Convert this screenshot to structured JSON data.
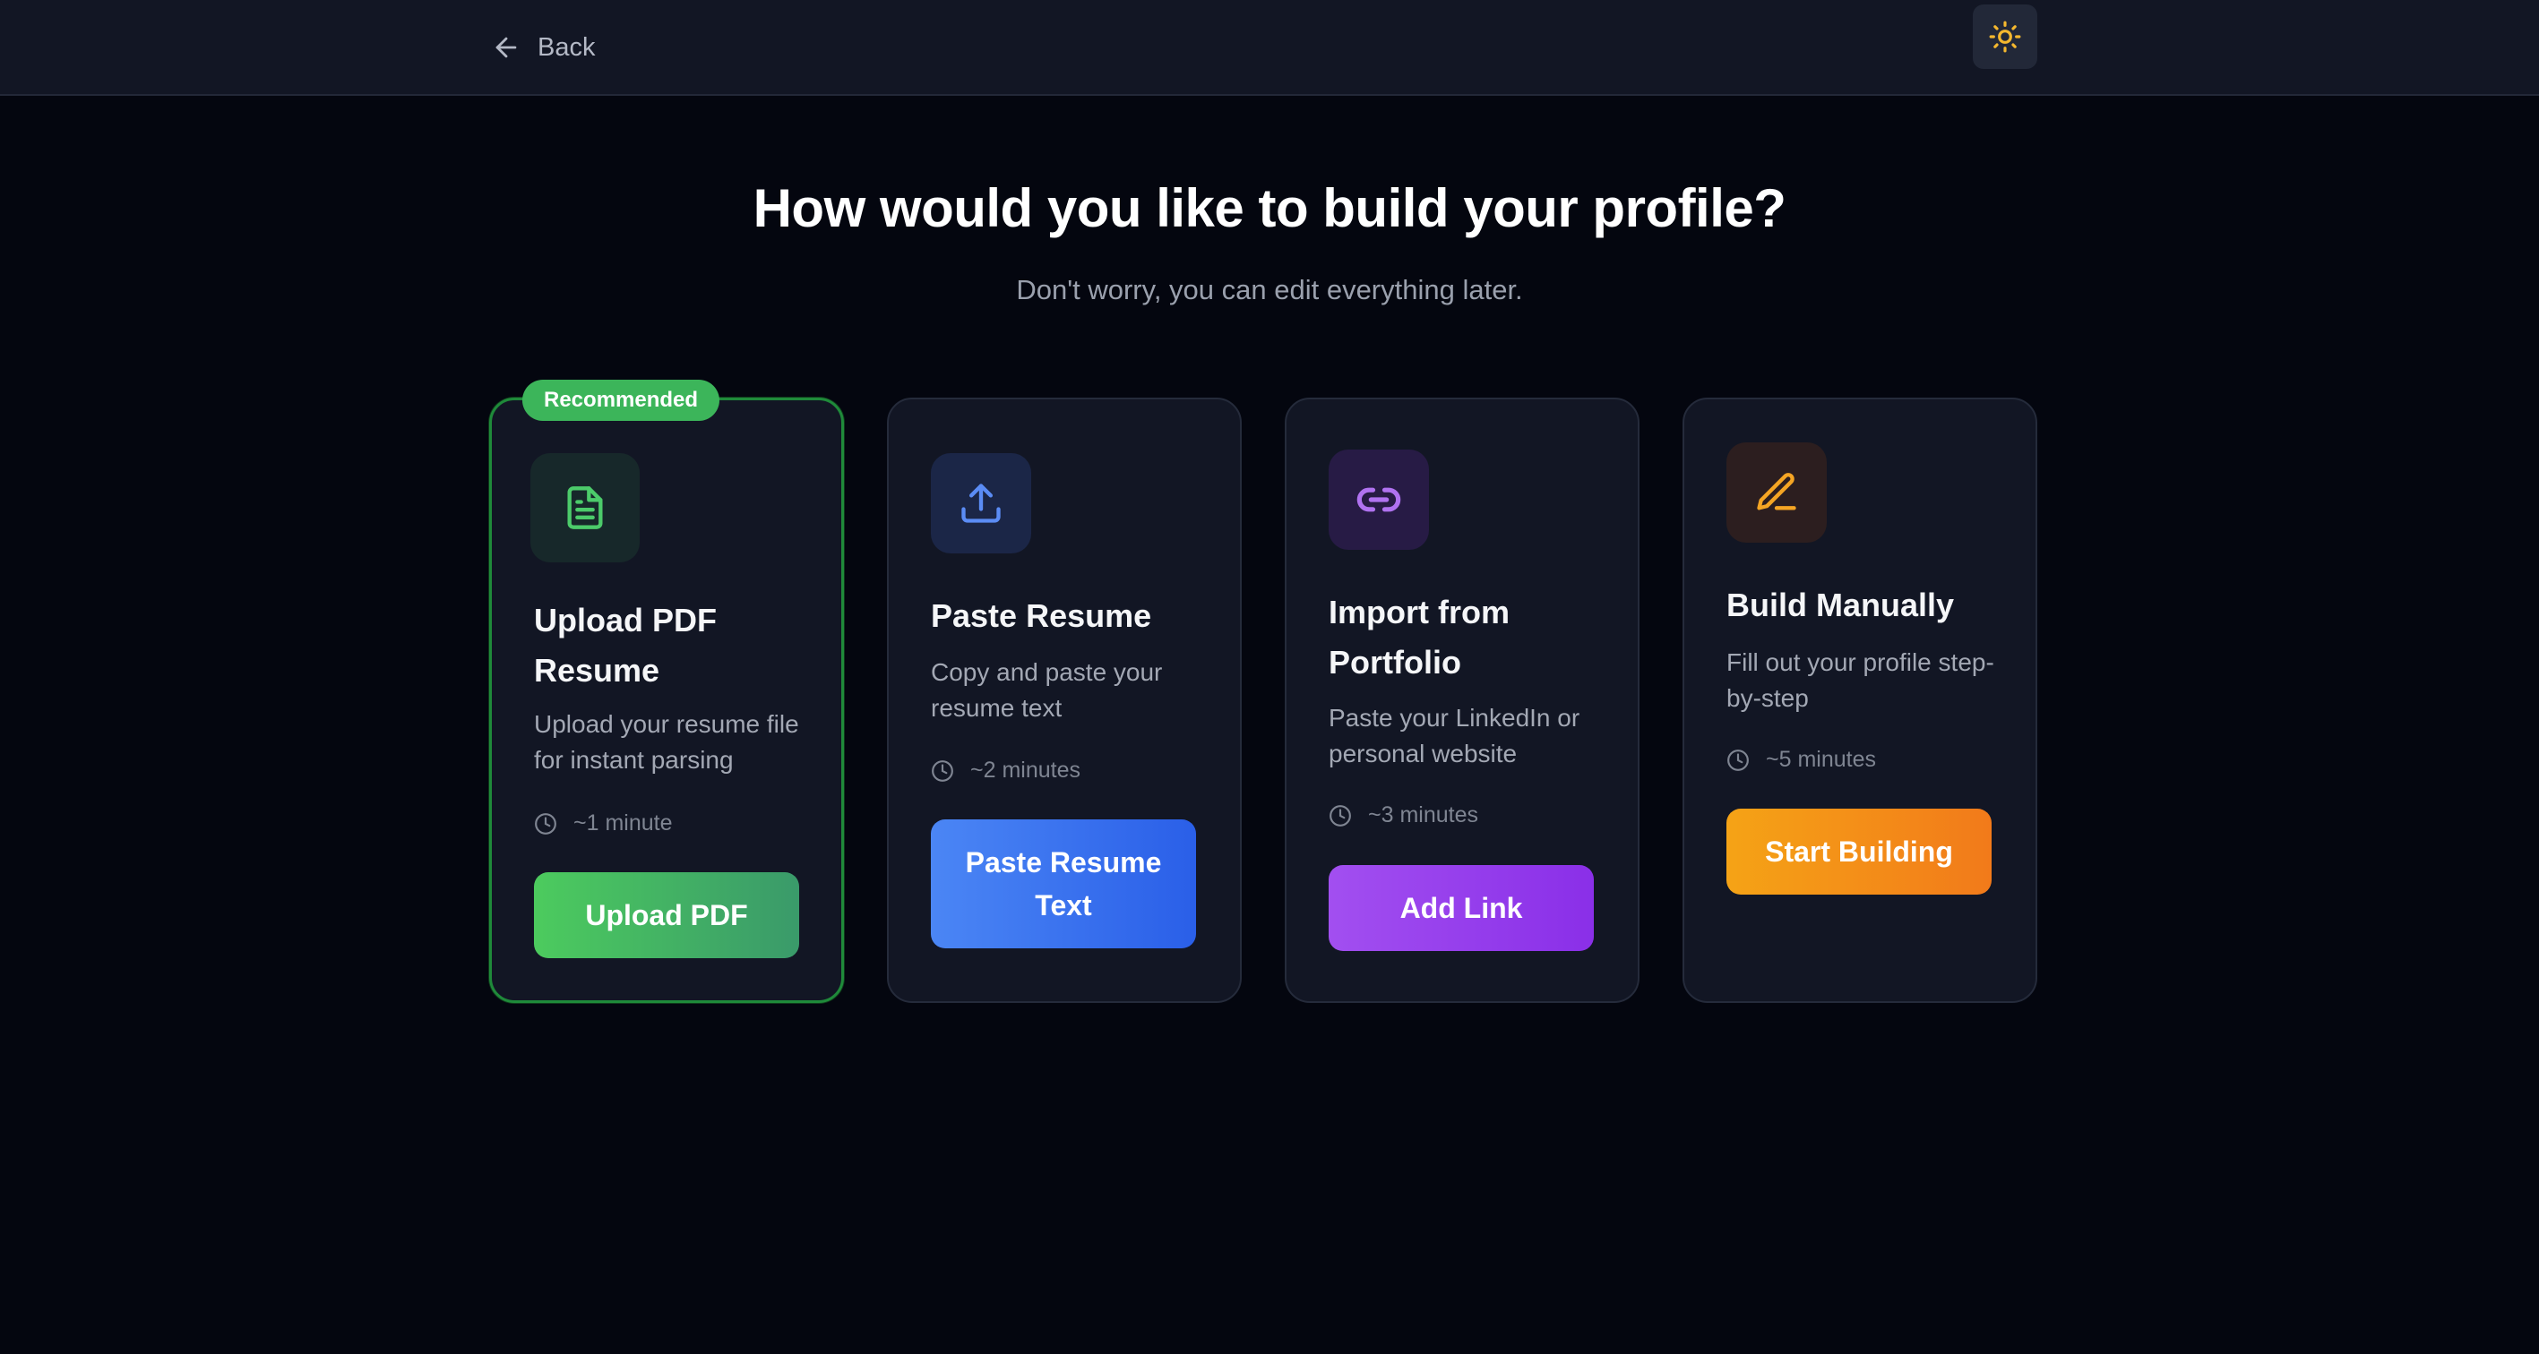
{
  "header": {
    "back_label": "Back"
  },
  "main": {
    "title": "How would you like to build your profile?",
    "subtitle": "Don't worry, you can edit everything later."
  },
  "cards": [
    {
      "badge": "Recommended",
      "title": "Upload PDF Resume",
      "description": "Upload your resume file for instant parsing",
      "time": "~1 minute",
      "button": "Upload PDF",
      "icon": "file-text-icon",
      "accent": "#4ccb6a"
    },
    {
      "title": "Paste Resume",
      "description": "Copy and paste your resume text",
      "time": "~2 minutes",
      "button": "Paste Resume Text",
      "icon": "upload-icon",
      "accent": "#5b8cf5"
    },
    {
      "title": "Import from Portfolio",
      "description": "Paste your LinkedIn or personal website",
      "time": "~3 minutes",
      "button": "Add Link",
      "icon": "link-icon",
      "accent": "#b072f0"
    },
    {
      "title": "Build Manually",
      "description": "Fill out your profile step-by-step",
      "time": "~5 minutes",
      "button": "Start Building",
      "icon": "pencil-icon",
      "accent": "#f5a524"
    }
  ],
  "theme_toggle_icon": "sun-icon"
}
